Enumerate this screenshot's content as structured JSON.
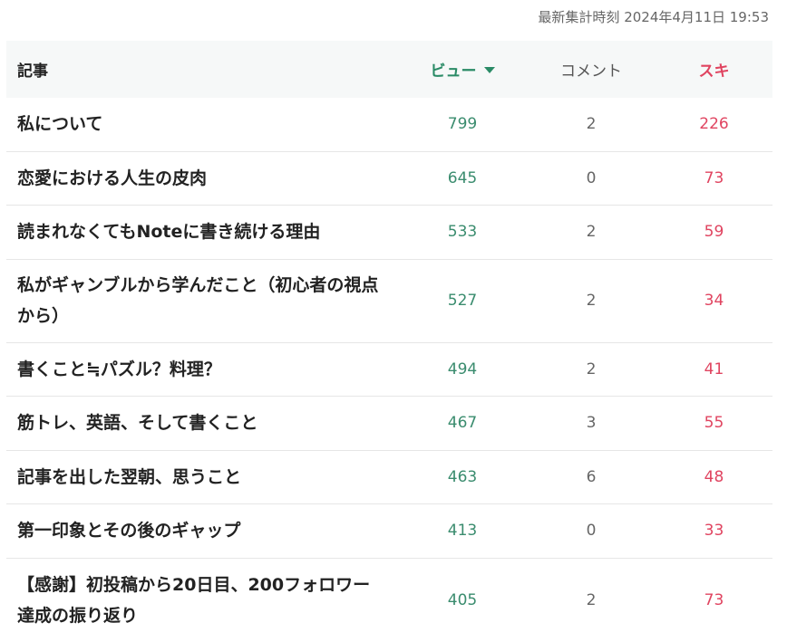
{
  "timestamp": "最新集計時刻 2024年4月11日 19:53",
  "table": {
    "headers": {
      "title": "記事",
      "views": "ビュー",
      "comments": "コメント",
      "likes": "スキ"
    },
    "sort_icon": "triangle-down-icon",
    "colors": {
      "views": "#2a8b66",
      "likes": "#e04460"
    },
    "rows": [
      {
        "title": "私について",
        "views": "799",
        "comments": "2",
        "likes": "226"
      },
      {
        "title": "恋愛における人生の皮肉",
        "views": "645",
        "comments": "0",
        "likes": "73"
      },
      {
        "title": "読まれなくてもNoteに書き続ける理由",
        "views": "533",
        "comments": "2",
        "likes": "59"
      },
      {
        "title": "私がギャンブルから学んだこと（初心者の視点から）",
        "views": "527",
        "comments": "2",
        "likes": "34"
      },
      {
        "title": "書くこと≒パズル？料理？",
        "views": "494",
        "comments": "2",
        "likes": "41"
      },
      {
        "title": "筋トレ、英語、そして書くこと",
        "views": "467",
        "comments": "3",
        "likes": "55"
      },
      {
        "title": "記事を出した翌朝、思うこと",
        "views": "463",
        "comments": "6",
        "likes": "48"
      },
      {
        "title": "第一印象とその後のギャップ",
        "views": "413",
        "comments": "0",
        "likes": "33"
      },
      {
        "title": "【感謝】初投稿から20日目、200フォロワー達成の振り返り",
        "views": "405",
        "comments": "2",
        "likes": "73"
      }
    ]
  }
}
